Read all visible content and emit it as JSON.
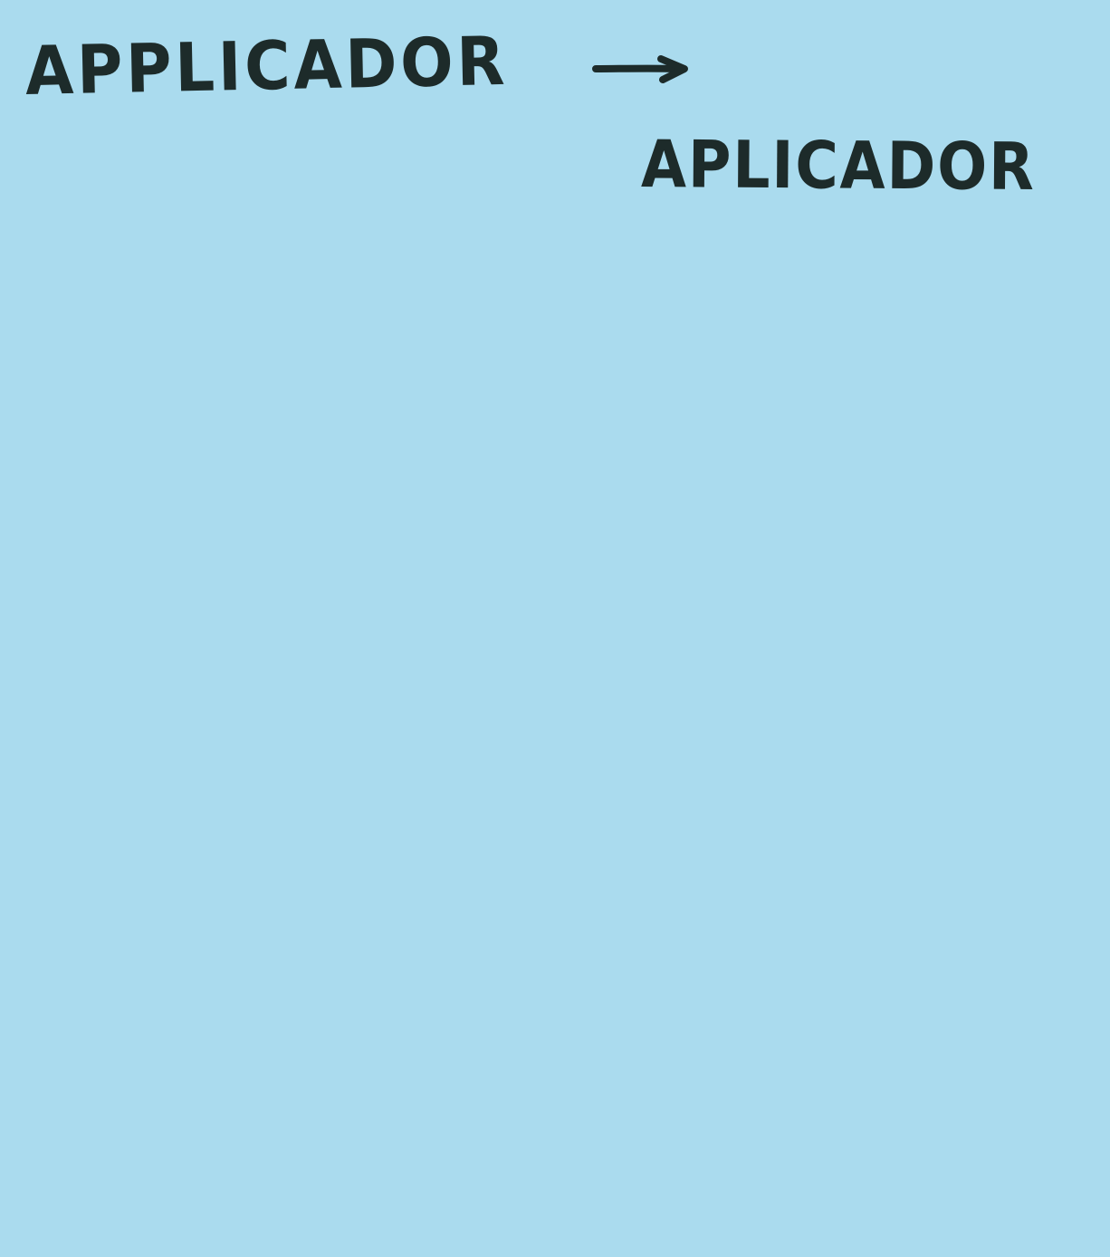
{
  "note": {
    "background_color": "#aadbee",
    "ink_color": "#1d2b2a",
    "original_word": "APPLICADOR",
    "arrow_icon": "right-arrow-icon",
    "corrected_word": "APLICADOR"
  }
}
